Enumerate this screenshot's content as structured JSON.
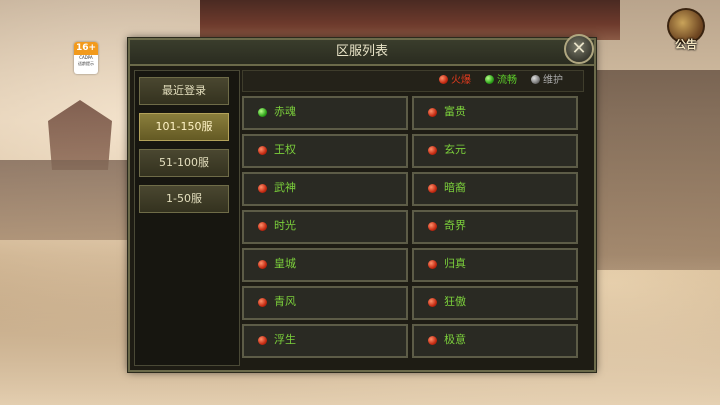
{
  "age_rating": {
    "number": "16+",
    "org": "CADPA",
    "label": "适龄提示"
  },
  "notice": {
    "label": "公告"
  },
  "panel": {
    "title": "区服列表",
    "close_symbol": "✕"
  },
  "sidebar": {
    "items": [
      {
        "label": "最近登录",
        "active": false
      },
      {
        "label": "101-150服",
        "active": true
      },
      {
        "label": "51-100服",
        "active": false
      },
      {
        "label": "1-50服",
        "active": false
      }
    ]
  },
  "legend": {
    "hot": {
      "label": "火爆",
      "color": "#e03a1e"
    },
    "smooth": {
      "label": "流畅",
      "color": "#5fd12b"
    },
    "maintenance": {
      "label": "维护",
      "color": "#9a9a9a"
    }
  },
  "servers": [
    {
      "name": "赤魂",
      "status": "smooth"
    },
    {
      "name": "富贵",
      "status": "hot"
    },
    {
      "name": "王权",
      "status": "hot"
    },
    {
      "name": "玄元",
      "status": "hot"
    },
    {
      "name": "武神",
      "status": "hot"
    },
    {
      "name": "暗裔",
      "status": "hot"
    },
    {
      "name": "时光",
      "status": "hot"
    },
    {
      "name": "奇界",
      "status": "hot"
    },
    {
      "name": "皇城",
      "status": "hot"
    },
    {
      "name": "归真",
      "status": "hot"
    },
    {
      "name": "青风",
      "status": "hot"
    },
    {
      "name": "狂傲",
      "status": "hot"
    },
    {
      "name": "浮生",
      "status": "hot"
    },
    {
      "name": "极意",
      "status": "hot"
    }
  ]
}
